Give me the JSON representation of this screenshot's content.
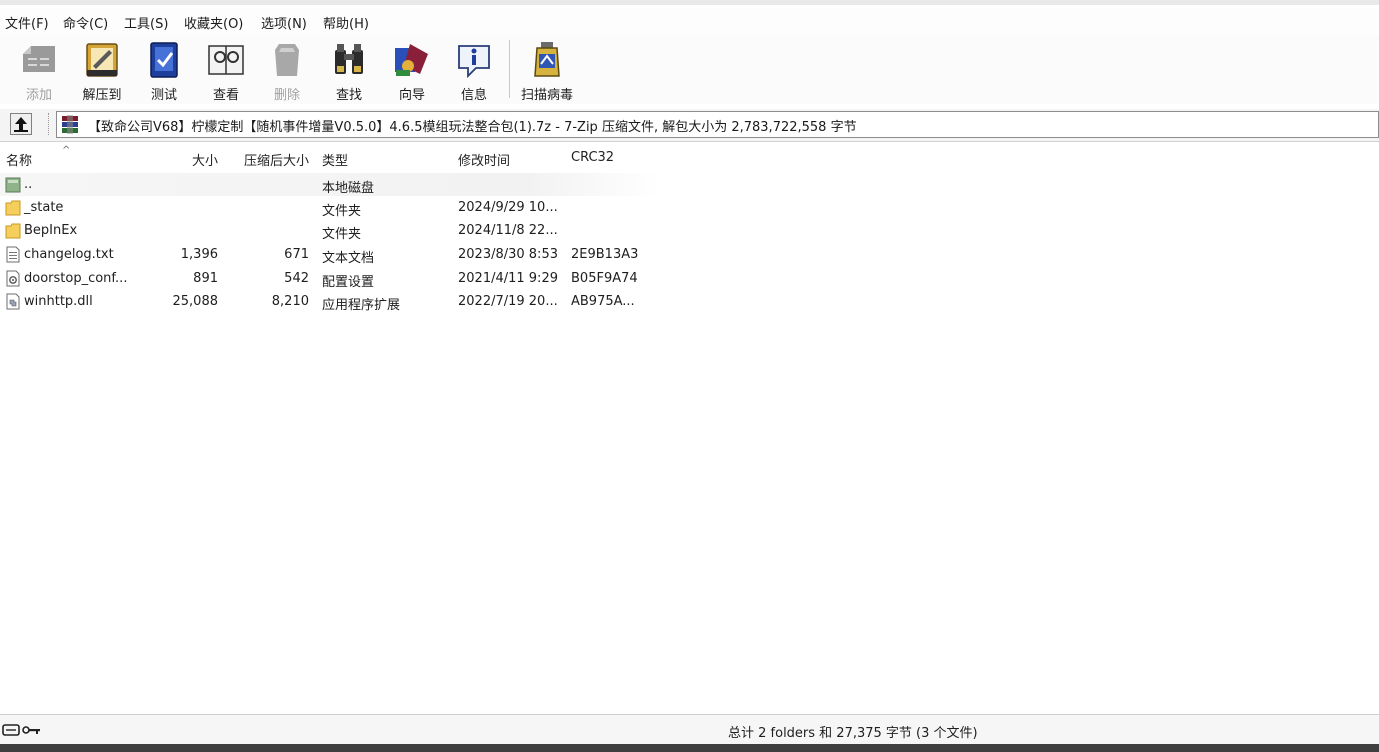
{
  "menu": {
    "items": [
      "文件(F)",
      "命令(C)",
      "工具(S)",
      "收藏夹(O)",
      "选项(N)",
      "帮助(H)"
    ]
  },
  "toolbar": {
    "buttons": [
      {
        "label": "添加",
        "icon": "add-icon",
        "enabled": false
      },
      {
        "label": "解压到",
        "icon": "extract-to-icon",
        "enabled": true
      },
      {
        "label": "测试",
        "icon": "test-icon",
        "enabled": true
      },
      {
        "label": "查看",
        "icon": "view-icon",
        "enabled": true
      },
      {
        "label": "删除",
        "icon": "delete-icon",
        "enabled": false
      },
      {
        "label": "查找",
        "icon": "find-icon",
        "enabled": true
      },
      {
        "label": "向导",
        "icon": "wizard-icon",
        "enabled": true
      },
      {
        "label": "信息",
        "icon": "info-icon",
        "enabled": true
      },
      {
        "label": "扫描病毒",
        "icon": "virus-scan-icon",
        "enabled": true
      }
    ]
  },
  "pathbar": {
    "text": "【致命公司V68】柠檬定制【随机事件增量V0.5.0】4.6.5模组玩法整合包(1).7z - 7-Zip 压缩文件, 解包大小为 2,783,722,558 字节"
  },
  "list": {
    "columns": {
      "name": "名称",
      "size": "大小",
      "packed": "压缩后大小",
      "type": "类型",
      "modified": "修改时间",
      "crc": "CRC32"
    },
    "rows": [
      {
        "name": "..",
        "size": "",
        "packed": "",
        "type": "本地磁盘",
        "modified": "",
        "crc": "",
        "icon": "parent-folder-icon"
      },
      {
        "name": "_state",
        "size": "",
        "packed": "",
        "type": "文件夹",
        "modified": "2024/9/29 10...",
        "crc": "",
        "icon": "folder-icon"
      },
      {
        "name": "BepInEx",
        "size": "",
        "packed": "",
        "type": "文件夹",
        "modified": "2024/11/8 22...",
        "crc": "",
        "icon": "folder-icon"
      },
      {
        "name": "changelog.txt",
        "size": "1,396",
        "packed": "671",
        "type": "文本文档",
        "modified": "2023/8/30 8:53",
        "crc": "2E9B13A3",
        "icon": "text-file-icon"
      },
      {
        "name": "doorstop_conf...",
        "size": "891",
        "packed": "542",
        "type": "配置设置",
        "modified": "2021/4/11 9:29",
        "crc": "B05F9A74",
        "icon": "config-file-icon"
      },
      {
        "name": "winhttp.dll",
        "size": "25,088",
        "packed": "8,210",
        "type": "应用程序扩展",
        "modified": "2022/7/19 20...",
        "crc": "AB975A...",
        "icon": "dll-file-icon"
      }
    ]
  },
  "status": {
    "text": "总计 2 folders 和 27,375 字节 (3 个文件)"
  }
}
